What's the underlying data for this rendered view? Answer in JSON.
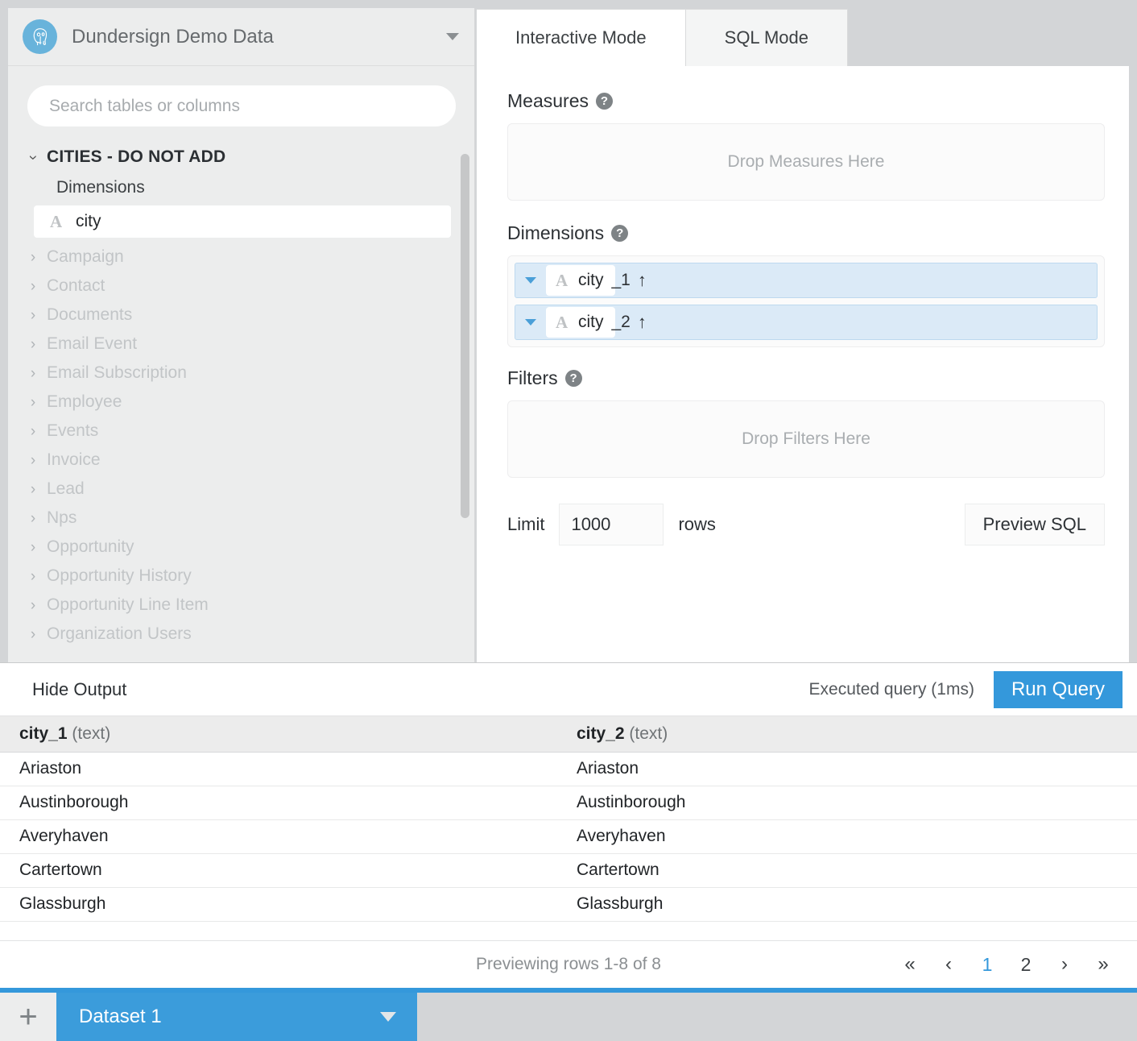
{
  "sidebar": {
    "datasource_name": "Dundersign Demo Data",
    "datasource_icon": "postgres-elephant-icon",
    "dropdown_icon": "chevron-down-icon",
    "search": {
      "placeholder": "Search tables or columns",
      "value": ""
    },
    "expanded_table": {
      "name": "CITIES - DO NOT ADD",
      "group_label": "Dimensions",
      "fields": [
        {
          "name": "city",
          "type_glyph": "A",
          "type": "text"
        }
      ]
    },
    "tables": [
      {
        "label": "Campaign"
      },
      {
        "label": "Contact"
      },
      {
        "label": "Documents"
      },
      {
        "label": "Email Event"
      },
      {
        "label": "Email Subscription"
      },
      {
        "label": "Employee"
      },
      {
        "label": "Events"
      },
      {
        "label": "Invoice"
      },
      {
        "label": "Lead"
      },
      {
        "label": "Nps"
      },
      {
        "label": "Opportunity"
      },
      {
        "label": "Opportunity History"
      },
      {
        "label": "Opportunity Line Item"
      },
      {
        "label": "Organization Users"
      }
    ]
  },
  "editor": {
    "tabs": [
      {
        "label": "Interactive Mode",
        "active": true
      },
      {
        "label": "SQL Mode",
        "active": false
      }
    ],
    "measures": {
      "label": "Measures",
      "help": "?",
      "placeholder": "Drop Measures Here"
    },
    "dimensions": {
      "label": "Dimensions",
      "help": "?",
      "chips": [
        {
          "type_glyph": "A",
          "field": "city",
          "alias_suffix": "_1",
          "sort_icon": "↑"
        },
        {
          "type_glyph": "A",
          "field": "city",
          "alias_suffix": "_2",
          "sort_icon": "↑"
        }
      ]
    },
    "filters": {
      "label": "Filters",
      "help": "?",
      "placeholder": "Drop Filters Here"
    },
    "limit": {
      "label": "Limit",
      "value": "1000",
      "unit": "rows"
    },
    "preview_sql_label": "Preview SQL"
  },
  "output": {
    "hide_output_label": "Hide Output",
    "status": "Executed query (1ms)",
    "run_query_label": "Run Query",
    "columns": [
      {
        "name": "city_1",
        "type": "(text)"
      },
      {
        "name": "city_2",
        "type": "(text)"
      }
    ],
    "rows": [
      [
        "Ariaston",
        "Ariaston"
      ],
      [
        "Austinborough",
        "Austinborough"
      ],
      [
        "Averyhaven",
        "Averyhaven"
      ],
      [
        "Cartertown",
        "Cartertown"
      ],
      [
        "Glassburgh",
        "Glassburgh"
      ]
    ],
    "pager": {
      "text": "Previewing rows 1-8 of 8",
      "first": "«",
      "prev": "‹",
      "pages": [
        "1",
        "2"
      ],
      "current_page": "1",
      "next": "›",
      "last": "»"
    }
  },
  "bottom": {
    "add_tab_label": "+",
    "dataset_tab_label": "Dataset 1",
    "dataset_tab_caret": "caret-down-icon"
  },
  "colors": {
    "accent": "#3498db",
    "tab_blue": "#3b9cdb",
    "chip_bg": "#dbeaf7",
    "logo_blue": "#68b3db"
  }
}
